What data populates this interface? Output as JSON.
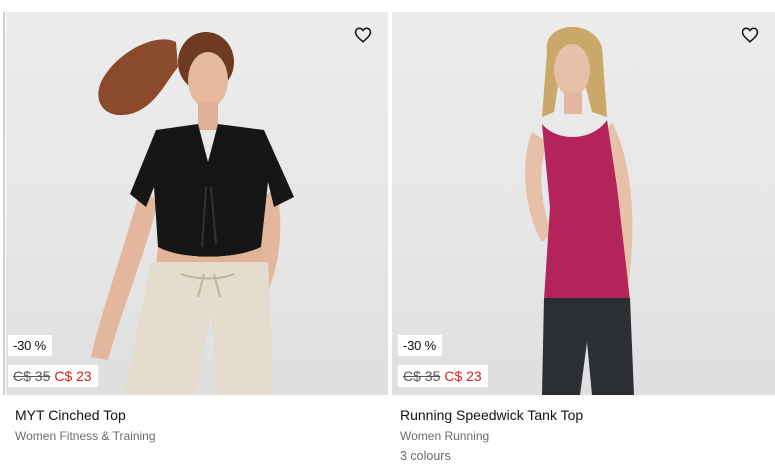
{
  "products": [
    {
      "discount": "-30 %",
      "old_price": "C$ 35",
      "new_price": "C$ 23",
      "title": "MYT Cinched Top",
      "subtitle": "Women Fitness & Training",
      "wishlist_icon": "heart-outline-icon"
    },
    {
      "discount": "-30 %",
      "old_price": "C$ 35",
      "new_price": "C$ 23",
      "title": "Running Speedwick Tank Top",
      "subtitle": "Women Running",
      "colours": "3 colours",
      "wishlist_icon": "heart-outline-icon"
    }
  ],
  "colors": {
    "sale_red": "#d8231b",
    "text": "#111111",
    "muted": "#6b6b6b",
    "image_bg": "#e8e8e8"
  }
}
